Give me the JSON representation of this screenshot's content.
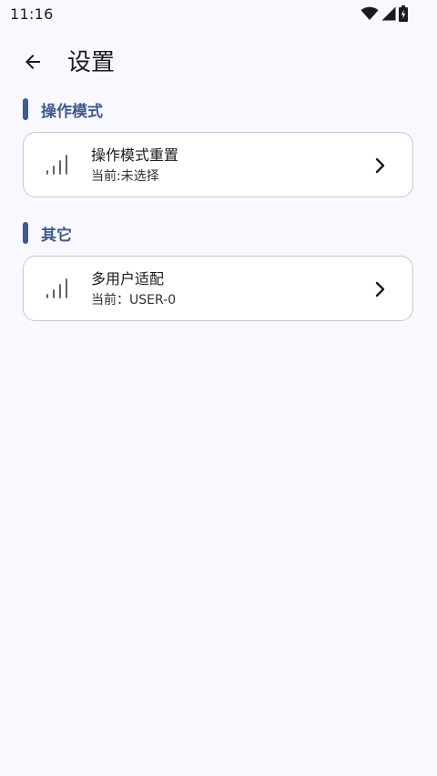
{
  "status_bar": {
    "time": "11:16",
    "icons": [
      "wifi-icon",
      "signal-icon",
      "battery-charging-icon"
    ]
  },
  "app_bar": {
    "back_icon": "arrow-back-icon",
    "title": "设置"
  },
  "sections": [
    {
      "title": "操作模式",
      "items": [
        {
          "title": "操作模式重置",
          "subtitle": "当前:未选择",
          "icon": "signal-bars-icon",
          "chevron": "chevron-right-icon"
        }
      ]
    },
    {
      "title": "其它",
      "items": [
        {
          "title": "多用户适配",
          "subtitle": "当前：USER-0",
          "icon": "signal-bars-icon",
          "chevron": "chevron-right-icon"
        }
      ]
    }
  ],
  "colors": {
    "background": "#f9f8ff",
    "accent": "#3f5a8f",
    "card_border": "#c9c7d1",
    "card_bg": "#ffffff"
  }
}
